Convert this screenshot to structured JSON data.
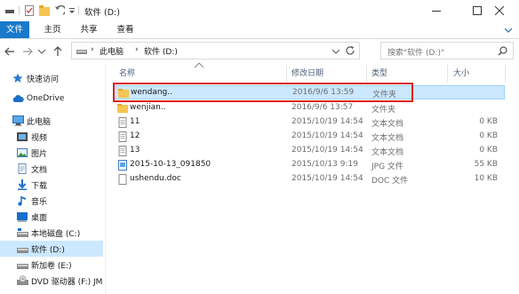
{
  "title": "软件 (D:)",
  "ribbon": {
    "tabs": [
      "文件",
      "主页",
      "共享",
      "查看"
    ]
  },
  "address": {
    "crumbs": [
      "此电脑",
      "软件 (D:)"
    ]
  },
  "search": {
    "placeholder": "搜索\"软件 (D:)\""
  },
  "navpane": {
    "items": [
      {
        "label": "快速访问",
        "icon": "star-icon"
      },
      {
        "label": "OneDrive",
        "icon": "cloud-icon"
      },
      {
        "label": "此电脑",
        "icon": "computer-icon"
      },
      {
        "label": "视频",
        "icon": "video-icon"
      },
      {
        "label": "图片",
        "icon": "picture-icon"
      },
      {
        "label": "文档",
        "icon": "document-icon"
      },
      {
        "label": "下载",
        "icon": "download-icon"
      },
      {
        "label": "音乐",
        "icon": "music-icon"
      },
      {
        "label": "桌面",
        "icon": "desktop-icon"
      },
      {
        "label": "本地磁盘 (C:)",
        "icon": "drive-icon"
      },
      {
        "label": "软件 (D:)",
        "icon": "drive-icon"
      },
      {
        "label": "新加卷 (E:)",
        "icon": "drive-icon"
      },
      {
        "label": "DVD 驱动器 (F:) JM",
        "icon": "dvd-icon"
      }
    ]
  },
  "columns": {
    "name": "名称",
    "date": "修改日期",
    "type": "类型",
    "size": "大小"
  },
  "files": [
    {
      "name": "wendang..",
      "date": "2016/9/6 13:59",
      "type": "文件夹",
      "size": "",
      "icon": "folder-icon"
    },
    {
      "name": "wenjian..",
      "date": "2016/9/6 13:57",
      "type": "文件夹",
      "size": "",
      "icon": "folder-icon"
    },
    {
      "name": "11",
      "date": "2015/10/19 14:54",
      "type": "文本文档",
      "size": "0 KB",
      "icon": "text-file-icon"
    },
    {
      "name": "12",
      "date": "2015/10/19 14:54",
      "type": "文本文档",
      "size": "0 KB",
      "icon": "text-file-icon"
    },
    {
      "name": "13",
      "date": "2015/10/19 14:54",
      "type": "文本文档",
      "size": "0 KB",
      "icon": "text-file-icon"
    },
    {
      "name": "2015-10-13_091850",
      "date": "2015/10/13 9:19",
      "type": "JPG 文件",
      "size": "55 KB",
      "icon": "image-file-icon"
    },
    {
      "name": "ushendu.doc",
      "date": "2015/10/19 14:54",
      "type": "DOC 文件",
      "size": "10 KB",
      "icon": "doc-file-icon"
    }
  ],
  "colors": {
    "accent": "#1979ca",
    "selection": "#cce8ff",
    "highlight": "#e02020"
  }
}
